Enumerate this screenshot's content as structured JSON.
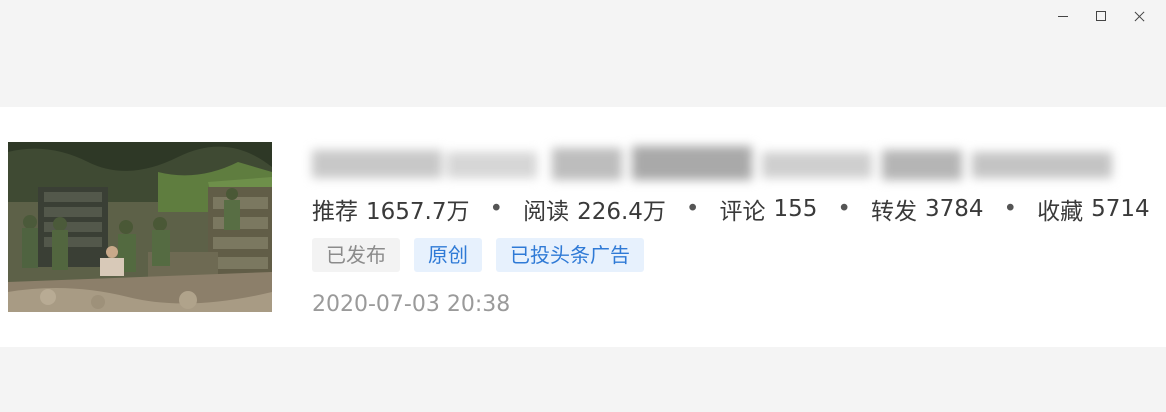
{
  "window": {
    "minimize_icon": "minimize-icon",
    "maximize_icon": "maximize-icon",
    "close_icon": "close-icon"
  },
  "article": {
    "stats": [
      {
        "label": "推荐",
        "value": "1657.7万"
      },
      {
        "label": "阅读",
        "value": "226.4万"
      },
      {
        "label": "评论",
        "value": "155"
      },
      {
        "label": "转发",
        "value": "3784"
      },
      {
        "label": "收藏",
        "value": "5714"
      }
    ],
    "separator": "•",
    "tags": [
      "已发布",
      "原创",
      "已投头条广告"
    ],
    "timestamp": "2020-07-03 20:38"
  },
  "colors": {
    "tag_blue_bg": "#e7f1fd",
    "tag_blue_text": "#2f7ad6",
    "tag_grey_bg": "#f3f3f3",
    "tag_grey_text": "#8b8b8b"
  }
}
